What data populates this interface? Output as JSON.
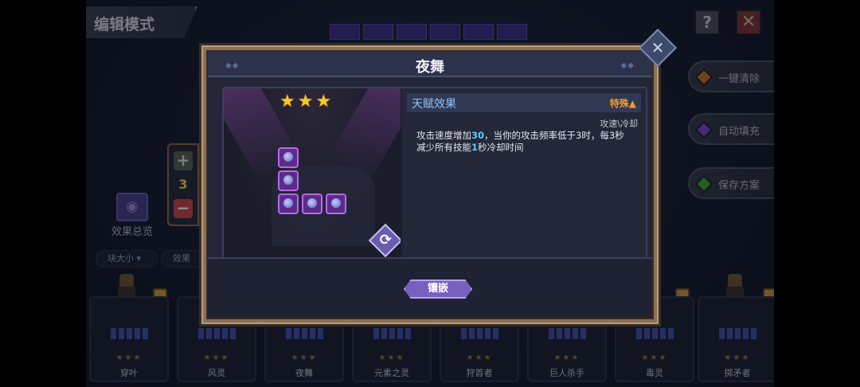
{
  "mode_title": "编辑模式",
  "top_right": {
    "help_label": "?",
    "close_label": "✕"
  },
  "side_buttons": [
    {
      "label": "一键清除",
      "gem_color": "#c2771c"
    },
    {
      "label": "自动填充",
      "gem_color": "#7a42c6"
    },
    {
      "label": "保存方案",
      "gem_color": "#3ea12c"
    }
  ],
  "effect_overview_label": "效果总览",
  "counter": {
    "plus": "+",
    "value": "3",
    "minus": "−"
  },
  "filters": [
    "块大小 ▾",
    "效果"
  ],
  "cards": [
    {
      "name": "穿叶",
      "stars": "★★★"
    },
    {
      "name": "风灵",
      "stars": "★★★"
    },
    {
      "name": "夜舞",
      "stars": "★★★"
    },
    {
      "name": "元素之灵",
      "stars": "★★★"
    },
    {
      "name": "狩首者",
      "stars": "★★★"
    },
    {
      "name": "巨人杀手",
      "stars": "★★★"
    },
    {
      "name": "毒灵",
      "stars": "★★★"
    },
    {
      "name": "掷矛者",
      "stars": "★★★"
    }
  ],
  "modal": {
    "title": "夜舞",
    "close_label": "✕",
    "stars": "★★★",
    "rotate_label": "⟳",
    "talent": {
      "heading": "天赋效果",
      "tag": "特殊▲",
      "category": "攻速\\冷却",
      "desc_1": "攻击速度增加",
      "desc_hl1": "30",
      "desc_2": "，当你的攻击频率低于3时，每3秒减少所有技能",
      "desc_hl2": "1",
      "desc_3": "秒冷却时间"
    },
    "inlay_button": "镶嵌"
  }
}
